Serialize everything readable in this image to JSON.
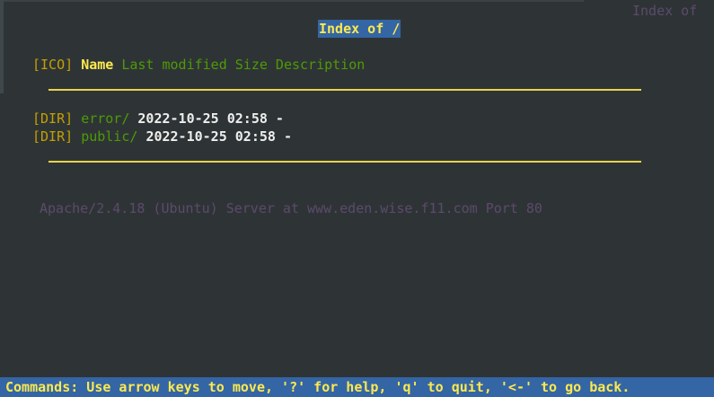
{
  "window": {
    "title_right": "Index of",
    "title_center": "Index of /"
  },
  "header": {
    "ico": "[ICO]",
    "name": "Name",
    "columns": "Last modified Size Description"
  },
  "rows": [
    {
      "ico": "[DIR]",
      "name": "error/",
      "modified": "2022-10-25 02:58 -"
    },
    {
      "ico": "[DIR]",
      "name": "public/",
      "modified": "2022-10-25 02:58 -"
    }
  ],
  "server_address": "Apache/2.4.18 (Ubuntu) Server at www.eden.wise.f11.com Port 80",
  "statusbar": {
    "text": "Commands: Use arrow keys to move, '?' for help, 'q' to quit, '<-' to go back."
  },
  "colors": {
    "background": "#2e3436",
    "yellow": "#fce94f",
    "status_bg": "#3465a4",
    "link_green": "#4e9a06",
    "bracket_olive": "#c4a000",
    "dim_purple": "#5c4a6b"
  }
}
